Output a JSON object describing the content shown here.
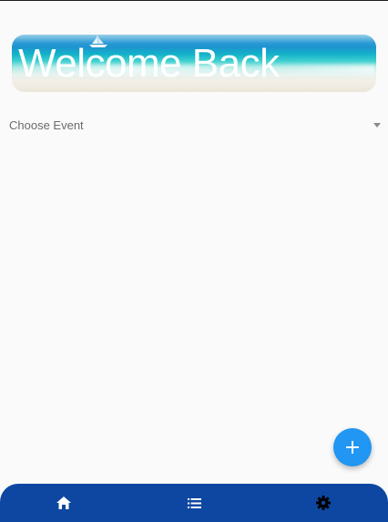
{
  "banner": {
    "title": "Welcome Back",
    "image": "beach-sea-image"
  },
  "event_select": {
    "placeholder": "Choose Event",
    "icon": "caret-down-icon"
  },
  "fab": {
    "icon": "plus-icon",
    "color": "#2196f3"
  },
  "bottom_nav": {
    "color": "#0d47a1",
    "items": [
      {
        "icon": "home-icon"
      },
      {
        "icon": "list-icon"
      },
      {
        "icon": "gear-icon"
      }
    ]
  }
}
